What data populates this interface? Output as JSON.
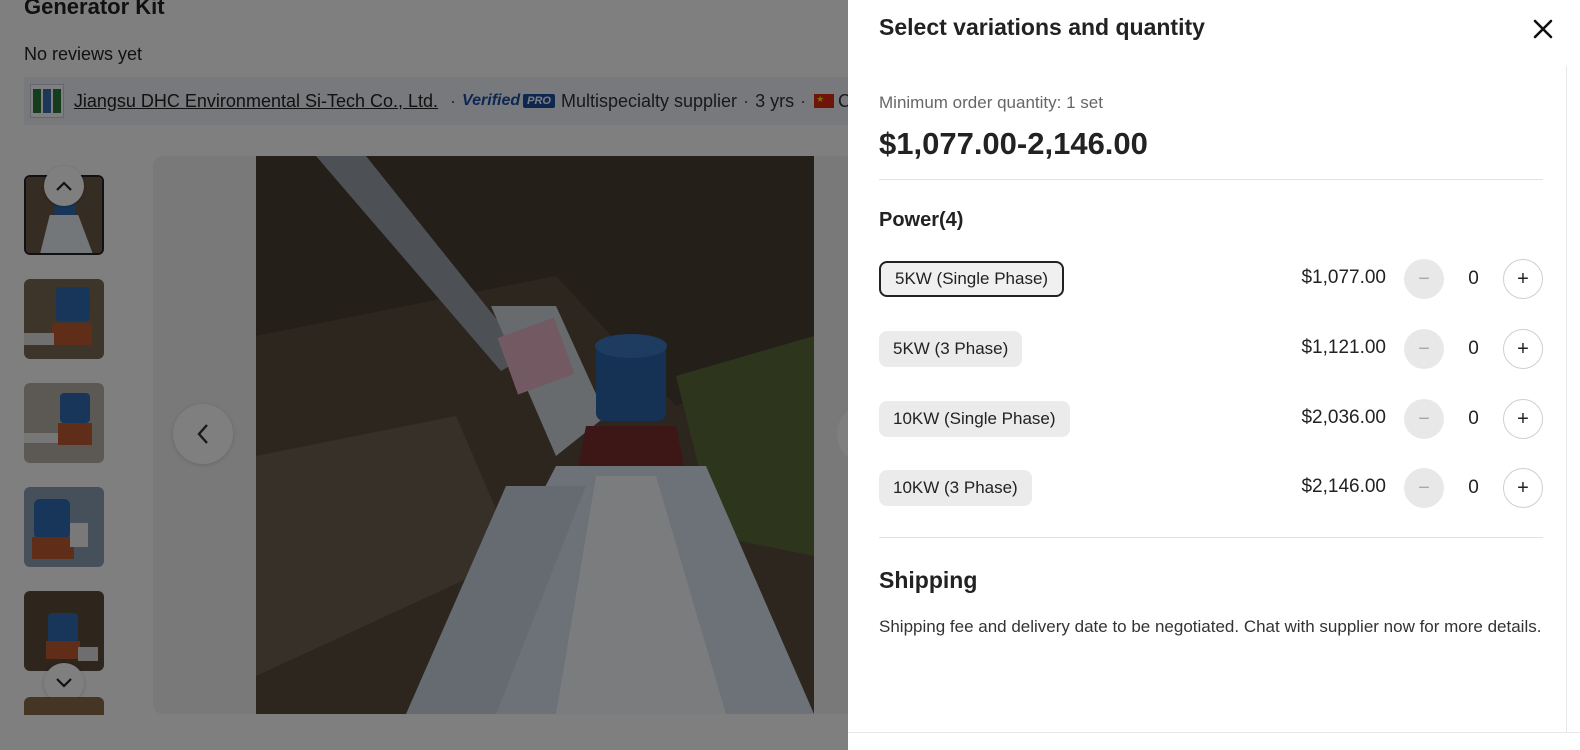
{
  "product": {
    "title": "Generator Kit",
    "reviews": "No reviews yet"
  },
  "supplier": {
    "name": "Jiangsu DHC Environmental Si-Tech Co., Ltd.",
    "verified": "Verified",
    "pro_badge": "PRO",
    "type": "Multispecialty supplier",
    "years": "3 yrs",
    "country": "CN"
  },
  "drawer": {
    "title": "Select variations and quantity",
    "min_order": "Minimum order quantity: 1 set",
    "price_range": "$1,077.00-2,146.00",
    "power_heading": "Power(4)",
    "variants": [
      {
        "label": "5KW (Single Phase)",
        "price": "$1,077.00",
        "qty": "0",
        "selected": true
      },
      {
        "label": "5KW (3 Phase)",
        "price": "$1,121.00",
        "qty": "0",
        "selected": false
      },
      {
        "label": "10KW (Single Phase)",
        "price": "$2,036.00",
        "qty": "0",
        "selected": false
      },
      {
        "label": "10KW (3 Phase)",
        "price": "$2,146.00",
        "qty": "0",
        "selected": false
      }
    ],
    "minus_symbol": "−",
    "plus_symbol": "+",
    "shipping_heading": "Shipping",
    "shipping_note": "Shipping fee and delivery date to be negotiated. Chat with supplier now for more details."
  },
  "icons": {
    "close": "close-icon",
    "thumb_up": "chevron-up-icon",
    "thumb_down": "chevron-down-icon",
    "gallery_prev": "chevron-left-icon"
  },
  "colors": {
    "overlay": "#000000",
    "verified_blue": "#1d4fa3",
    "chip_bg": "#ebebeb"
  }
}
